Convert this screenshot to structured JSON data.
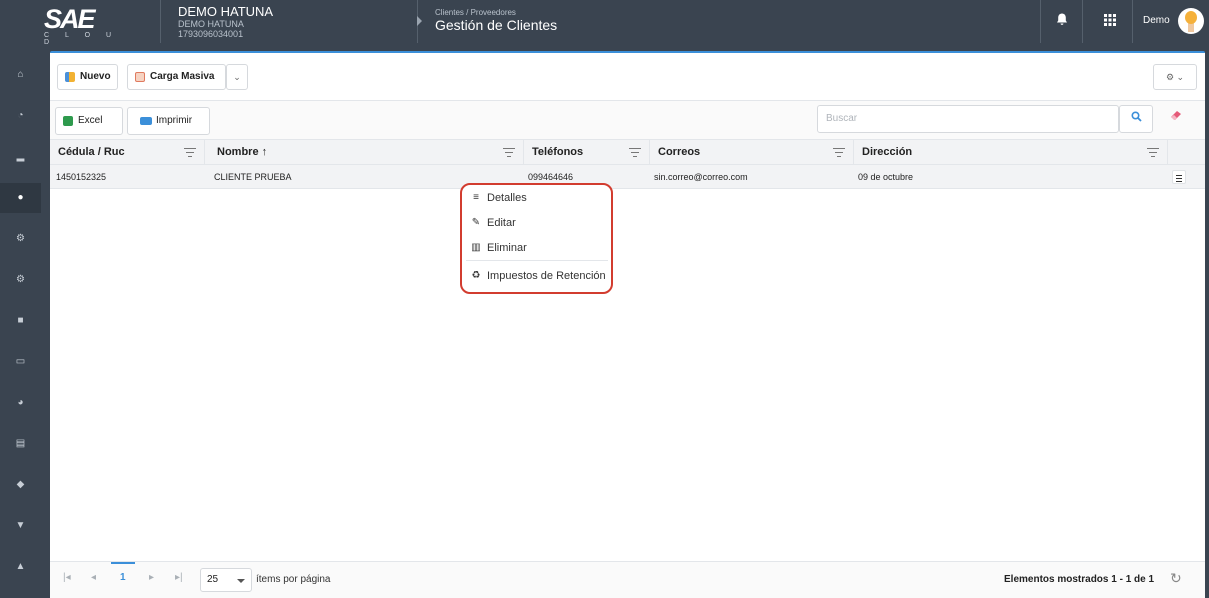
{
  "header": {
    "logo_text": "SAE",
    "logo_sub": "C L O U D",
    "company_name": "DEMO HATUNA",
    "company_subname": "DEMO HATUNA",
    "company_ruc": "1793096034001",
    "breadcrumb_parent": "Clientes / Proveedores",
    "page_title": "Gestión de Clientes",
    "user_name": "Demo",
    "bell_icon": "bell-icon",
    "apps_icon": "grid-icon"
  },
  "sidebar": {
    "items": [
      {
        "icon": "home-icon",
        "glyph": "⌂"
      },
      {
        "icon": "dashboard-icon",
        "glyph": "◔"
      },
      {
        "icon": "chart-icon",
        "glyph": "▂"
      },
      {
        "icon": "users-icon",
        "glyph": "●"
      },
      {
        "icon": "gears-icon",
        "glyph": "⚙"
      },
      {
        "icon": "gears-icon-2",
        "glyph": "⚙"
      },
      {
        "icon": "truck-icon",
        "glyph": "■"
      },
      {
        "icon": "card-icon",
        "glyph": "▭"
      },
      {
        "icon": "pie-icon",
        "glyph": "◕"
      },
      {
        "icon": "list-icon",
        "glyph": "▤"
      },
      {
        "icon": "shield-icon",
        "glyph": "◆"
      },
      {
        "icon": "cart-icon",
        "glyph": "▼"
      },
      {
        "icon": "bank-icon",
        "glyph": "▲"
      }
    ]
  },
  "toolbar": {
    "new_label": "Nuevo",
    "bulk_label": "Carga Masiva",
    "excel_label": "Excel",
    "print_label": "Imprimir",
    "search_placeholder": "Buscar"
  },
  "table": {
    "columns": [
      "Cédula / Ruc",
      "Nombre ↑",
      "Teléfonos",
      "Correos",
      "Dirección"
    ],
    "rows": [
      {
        "ruc": "1450152325",
        "name": "CLIENTE PRUEBA",
        "phone": "099464646",
        "email": "sin.correo@correo.com",
        "address": "09 de octubre"
      }
    ]
  },
  "context_menu": {
    "items": [
      "Detalles",
      "Editar",
      "Eliminar",
      "Impuestos de Retención"
    ]
  },
  "pager": {
    "current_page": "1",
    "page_size": "25",
    "page_size_label": "ítems por página",
    "shown_text": "Elementos mostrados 1 - 1 de 1"
  },
  "colors": {
    "header_bg": "#3a4450",
    "accent": "#3b8fd9",
    "highlight_border": "#d23c2f"
  }
}
